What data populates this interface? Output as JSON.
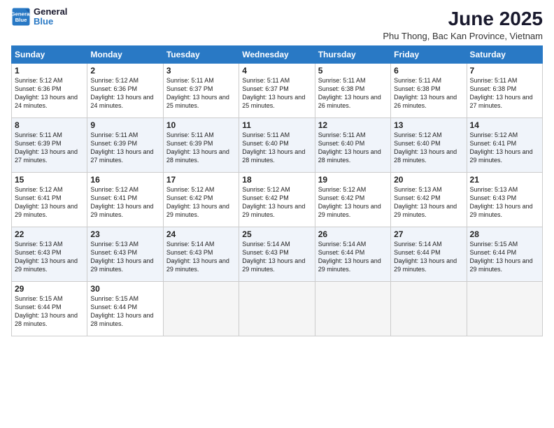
{
  "logo": {
    "line1": "General",
    "line2": "Blue"
  },
  "title": "June 2025",
  "subtitle": "Phu Thong, Bac Kan Province, Vietnam",
  "days_header": [
    "Sunday",
    "Monday",
    "Tuesday",
    "Wednesday",
    "Thursday",
    "Friday",
    "Saturday"
  ],
  "weeks": [
    [
      {
        "day": "1",
        "sunrise": "Sunrise: 5:12 AM",
        "sunset": "Sunset: 6:36 PM",
        "daylight": "Daylight: 13 hours and 24 minutes."
      },
      {
        "day": "2",
        "sunrise": "Sunrise: 5:12 AM",
        "sunset": "Sunset: 6:36 PM",
        "daylight": "Daylight: 13 hours and 24 minutes."
      },
      {
        "day": "3",
        "sunrise": "Sunrise: 5:11 AM",
        "sunset": "Sunset: 6:37 PM",
        "daylight": "Daylight: 13 hours and 25 minutes."
      },
      {
        "day": "4",
        "sunrise": "Sunrise: 5:11 AM",
        "sunset": "Sunset: 6:37 PM",
        "daylight": "Daylight: 13 hours and 25 minutes."
      },
      {
        "day": "5",
        "sunrise": "Sunrise: 5:11 AM",
        "sunset": "Sunset: 6:38 PM",
        "daylight": "Daylight: 13 hours and 26 minutes."
      },
      {
        "day": "6",
        "sunrise": "Sunrise: 5:11 AM",
        "sunset": "Sunset: 6:38 PM",
        "daylight": "Daylight: 13 hours and 26 minutes."
      },
      {
        "day": "7",
        "sunrise": "Sunrise: 5:11 AM",
        "sunset": "Sunset: 6:38 PM",
        "daylight": "Daylight: 13 hours and 27 minutes."
      }
    ],
    [
      {
        "day": "8",
        "sunrise": "Sunrise: 5:11 AM",
        "sunset": "Sunset: 6:39 PM",
        "daylight": "Daylight: 13 hours and 27 minutes."
      },
      {
        "day": "9",
        "sunrise": "Sunrise: 5:11 AM",
        "sunset": "Sunset: 6:39 PM",
        "daylight": "Daylight: 13 hours and 27 minutes."
      },
      {
        "day": "10",
        "sunrise": "Sunrise: 5:11 AM",
        "sunset": "Sunset: 6:39 PM",
        "daylight": "Daylight: 13 hours and 28 minutes."
      },
      {
        "day": "11",
        "sunrise": "Sunrise: 5:11 AM",
        "sunset": "Sunset: 6:40 PM",
        "daylight": "Daylight: 13 hours and 28 minutes."
      },
      {
        "day": "12",
        "sunrise": "Sunrise: 5:11 AM",
        "sunset": "Sunset: 6:40 PM",
        "daylight": "Daylight: 13 hours and 28 minutes."
      },
      {
        "day": "13",
        "sunrise": "Sunrise: 5:12 AM",
        "sunset": "Sunset: 6:40 PM",
        "daylight": "Daylight: 13 hours and 28 minutes."
      },
      {
        "day": "14",
        "sunrise": "Sunrise: 5:12 AM",
        "sunset": "Sunset: 6:41 PM",
        "daylight": "Daylight: 13 hours and 29 minutes."
      }
    ],
    [
      {
        "day": "15",
        "sunrise": "Sunrise: 5:12 AM",
        "sunset": "Sunset: 6:41 PM",
        "daylight": "Daylight: 13 hours and 29 minutes."
      },
      {
        "day": "16",
        "sunrise": "Sunrise: 5:12 AM",
        "sunset": "Sunset: 6:41 PM",
        "daylight": "Daylight: 13 hours and 29 minutes."
      },
      {
        "day": "17",
        "sunrise": "Sunrise: 5:12 AM",
        "sunset": "Sunset: 6:42 PM",
        "daylight": "Daylight: 13 hours and 29 minutes."
      },
      {
        "day": "18",
        "sunrise": "Sunrise: 5:12 AM",
        "sunset": "Sunset: 6:42 PM",
        "daylight": "Daylight: 13 hours and 29 minutes."
      },
      {
        "day": "19",
        "sunrise": "Sunrise: 5:12 AM",
        "sunset": "Sunset: 6:42 PM",
        "daylight": "Daylight: 13 hours and 29 minutes."
      },
      {
        "day": "20",
        "sunrise": "Sunrise: 5:13 AM",
        "sunset": "Sunset: 6:42 PM",
        "daylight": "Daylight: 13 hours and 29 minutes."
      },
      {
        "day": "21",
        "sunrise": "Sunrise: 5:13 AM",
        "sunset": "Sunset: 6:43 PM",
        "daylight": "Daylight: 13 hours and 29 minutes."
      }
    ],
    [
      {
        "day": "22",
        "sunrise": "Sunrise: 5:13 AM",
        "sunset": "Sunset: 6:43 PM",
        "daylight": "Daylight: 13 hours and 29 minutes."
      },
      {
        "day": "23",
        "sunrise": "Sunrise: 5:13 AM",
        "sunset": "Sunset: 6:43 PM",
        "daylight": "Daylight: 13 hours and 29 minutes."
      },
      {
        "day": "24",
        "sunrise": "Sunrise: 5:14 AM",
        "sunset": "Sunset: 6:43 PM",
        "daylight": "Daylight: 13 hours and 29 minutes."
      },
      {
        "day": "25",
        "sunrise": "Sunrise: 5:14 AM",
        "sunset": "Sunset: 6:43 PM",
        "daylight": "Daylight: 13 hours and 29 minutes."
      },
      {
        "day": "26",
        "sunrise": "Sunrise: 5:14 AM",
        "sunset": "Sunset: 6:44 PM",
        "daylight": "Daylight: 13 hours and 29 minutes."
      },
      {
        "day": "27",
        "sunrise": "Sunrise: 5:14 AM",
        "sunset": "Sunset: 6:44 PM",
        "daylight": "Daylight: 13 hours and 29 minutes."
      },
      {
        "day": "28",
        "sunrise": "Sunrise: 5:15 AM",
        "sunset": "Sunset: 6:44 PM",
        "daylight": "Daylight: 13 hours and 29 minutes."
      }
    ],
    [
      {
        "day": "29",
        "sunrise": "Sunrise: 5:15 AM",
        "sunset": "Sunset: 6:44 PM",
        "daylight": "Daylight: 13 hours and 28 minutes."
      },
      {
        "day": "30",
        "sunrise": "Sunrise: 5:15 AM",
        "sunset": "Sunset: 6:44 PM",
        "daylight": "Daylight: 13 hours and 28 minutes."
      },
      {
        "day": "",
        "sunrise": "",
        "sunset": "",
        "daylight": ""
      },
      {
        "day": "",
        "sunrise": "",
        "sunset": "",
        "daylight": ""
      },
      {
        "day": "",
        "sunrise": "",
        "sunset": "",
        "daylight": ""
      },
      {
        "day": "",
        "sunrise": "",
        "sunset": "",
        "daylight": ""
      },
      {
        "day": "",
        "sunrise": "",
        "sunset": "",
        "daylight": ""
      }
    ]
  ]
}
